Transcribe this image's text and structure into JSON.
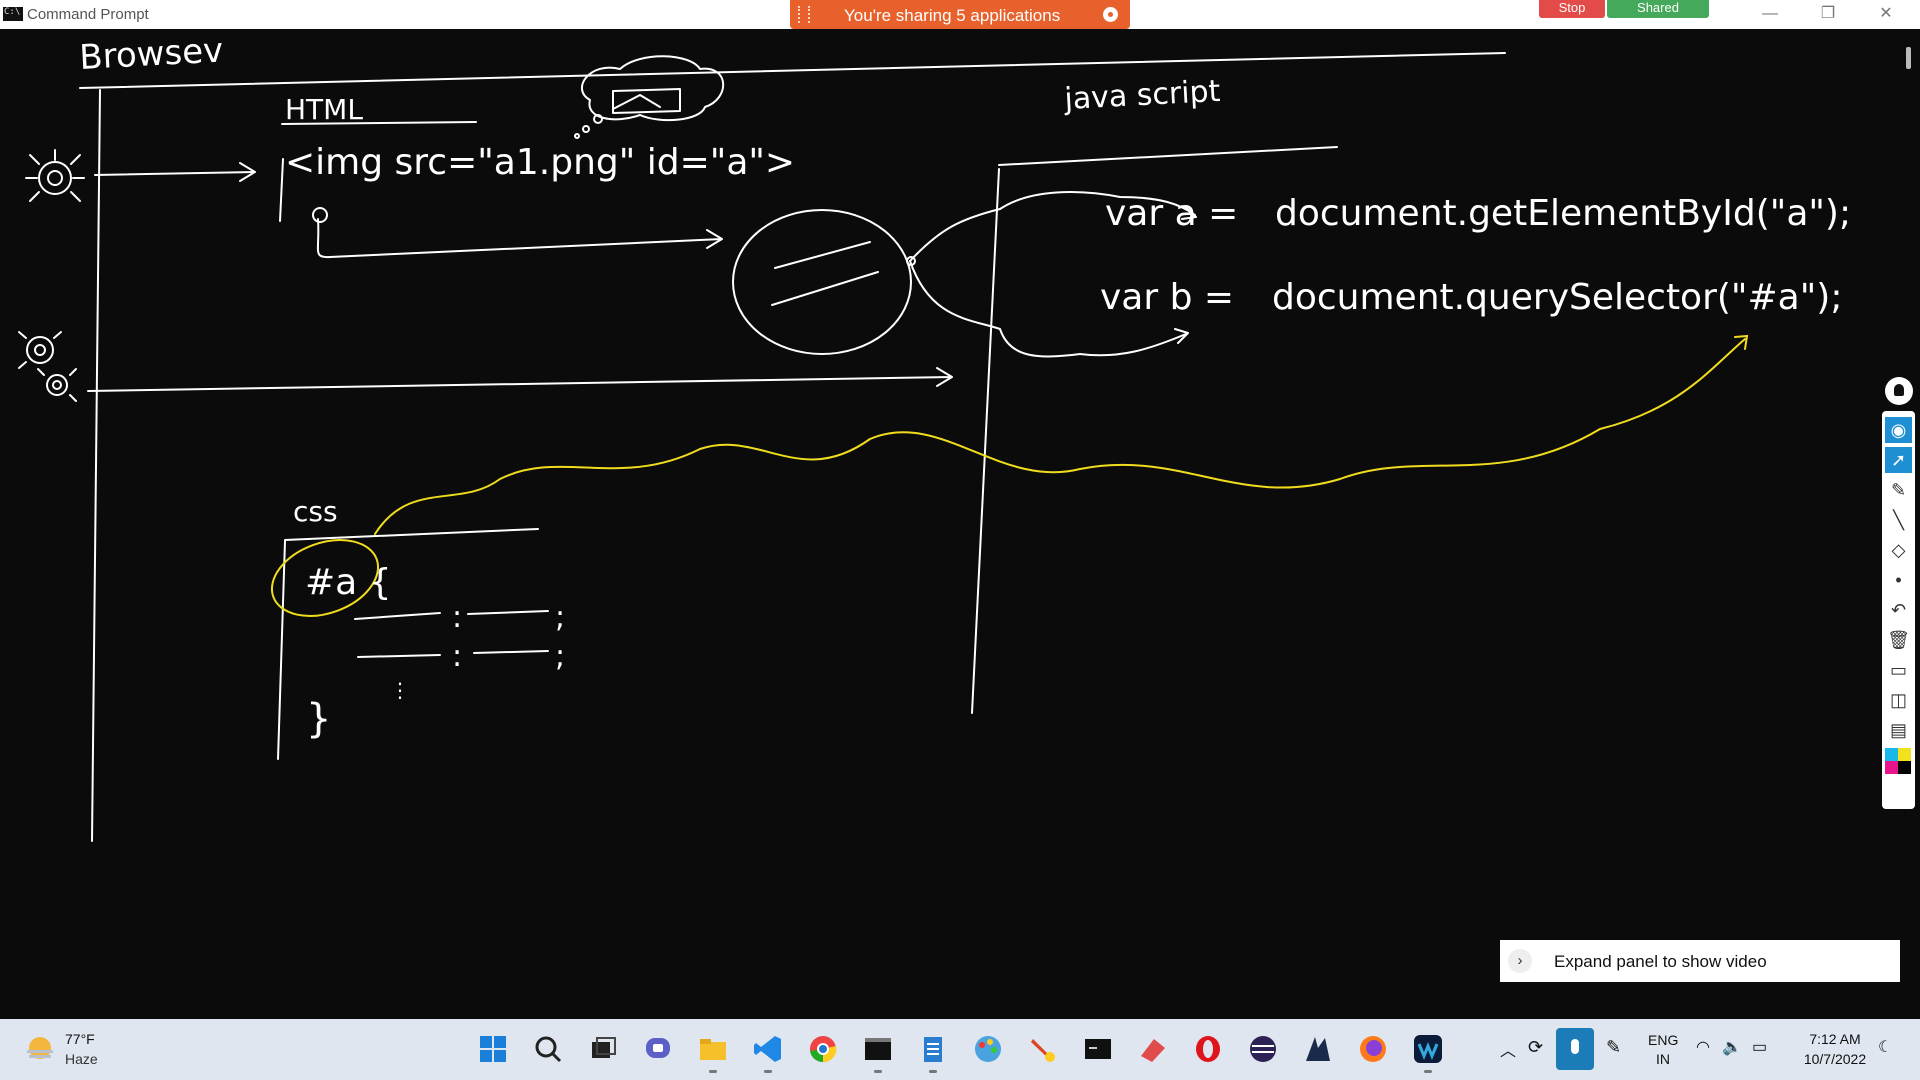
{
  "window": {
    "title": "Command Prompt"
  },
  "sharing": {
    "message": "You're sharing 5 applications",
    "stop_label": "Stop",
    "shared_label": "Shared"
  },
  "window_controls": {
    "minimize": "—",
    "restore": "❐",
    "close": "✕"
  },
  "whiteboard": {
    "browser_label": "Browsev",
    "html_heading": "HTML",
    "html_code": "<img src=\"a1.png\"  id=\"a\">",
    "js_heading": "java script",
    "js_line1_var": "var  a  =",
    "js_line1_call": "document.getElementById(\"a\");",
    "js_line2_var": "var  b  =",
    "js_line2_call": "document.querySelector(\"#a\");",
    "css_heading": "css",
    "css_selector": "#a {",
    "css_close": "}"
  },
  "ink_tools": [
    "eye",
    "pointer",
    "highlighter",
    "pen",
    "eraser",
    "dot",
    "undo",
    "trash",
    "screen",
    "camera",
    "clipboard"
  ],
  "ink_colors": [
    "#19b7ea",
    "#f2e21d",
    "#e8158a",
    "#000000"
  ],
  "expand_panel": {
    "label": "Expand panel to show video",
    "chevron": "›"
  },
  "taskbar": {
    "weather_temp": "77°F",
    "weather_condition": "Haze",
    "apps": [
      "start",
      "search",
      "task-view",
      "teams-chat",
      "file-explorer",
      "vscode",
      "chrome",
      "terminal",
      "notepad",
      "paint",
      "pen-app",
      "cmd",
      "app-red",
      "opera",
      "eclipse",
      "app-dark",
      "firefox",
      "webex"
    ],
    "language_line1": "ENG",
    "language_line2": "IN",
    "time": "7:12 AM",
    "date": "10/7/2022"
  }
}
